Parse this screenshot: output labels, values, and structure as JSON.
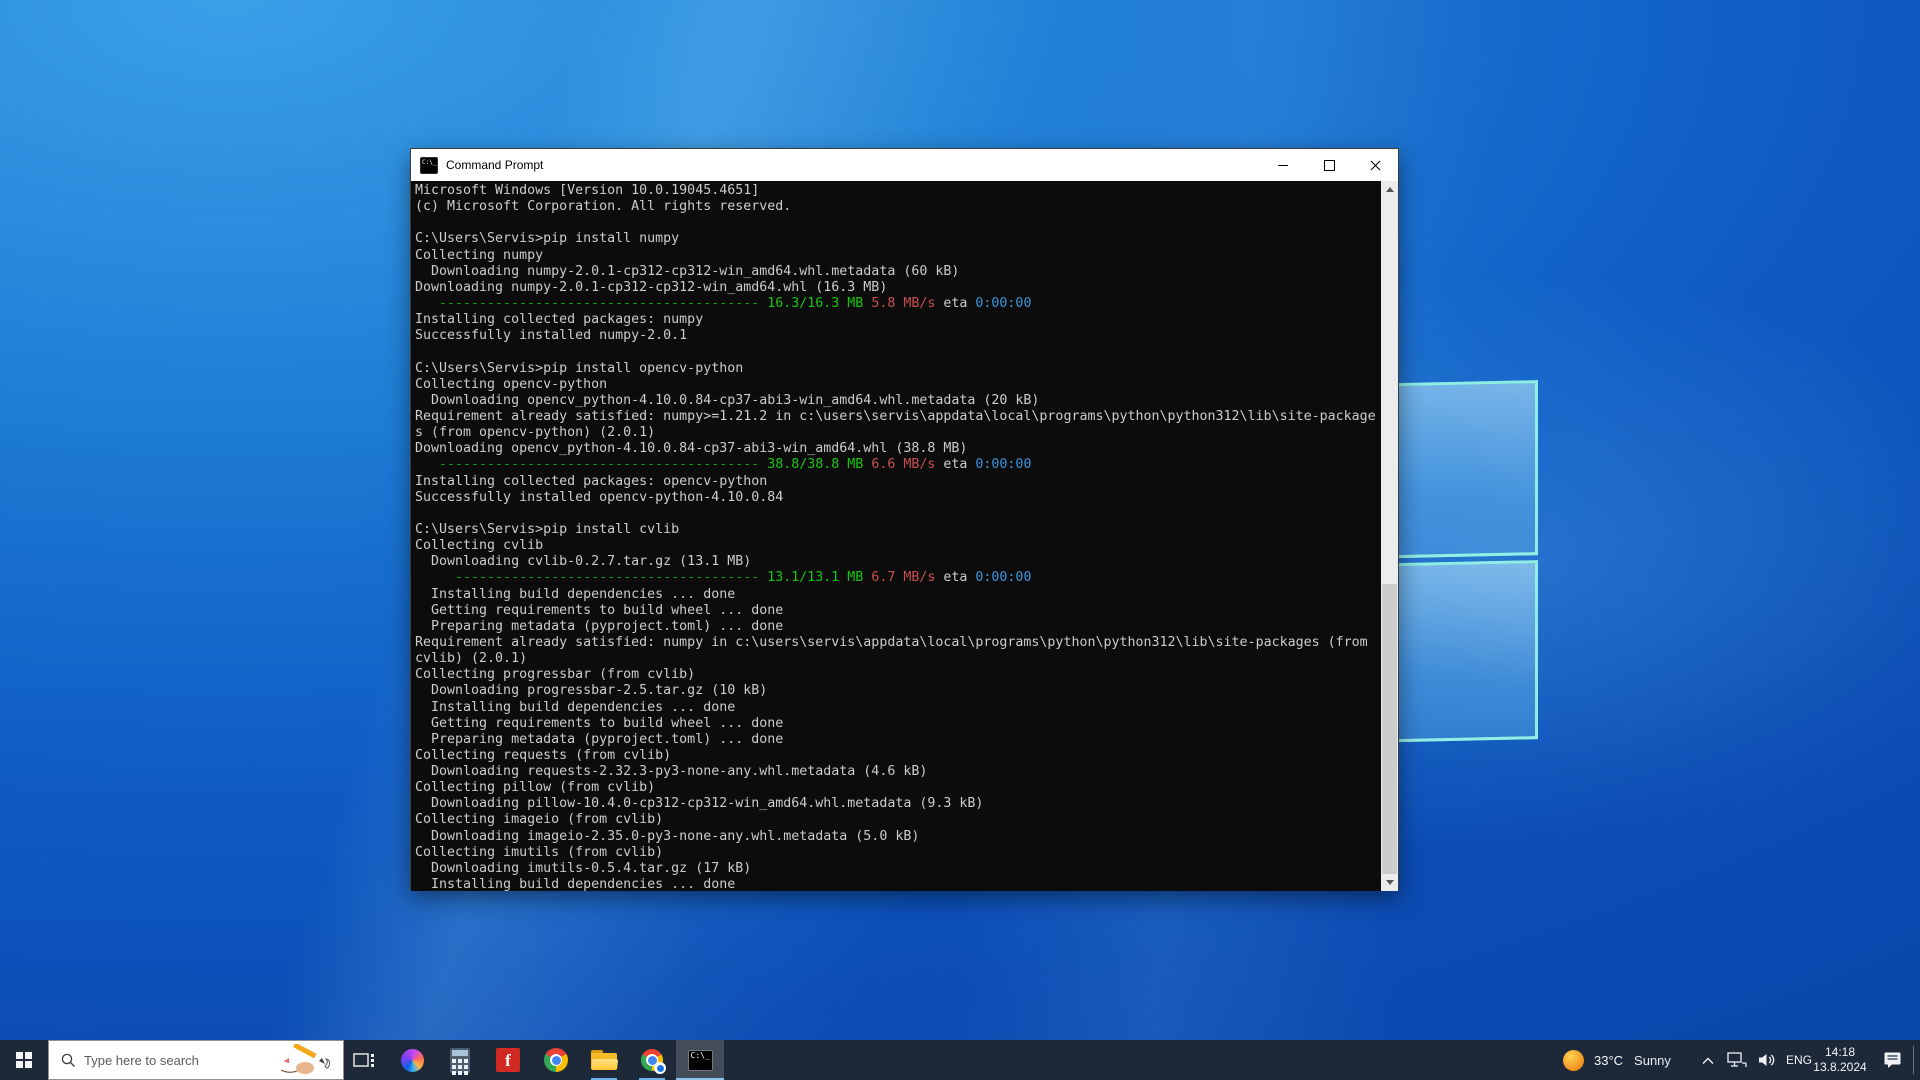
{
  "desktop": {
    "wallpaper_base": "#0d55c0",
    "logo_edge_color": "#94f2e4"
  },
  "window": {
    "title": "Command Prompt",
    "cmd_icon_text": "C:\\_",
    "controls": [
      "minimize",
      "maximize",
      "close"
    ],
    "terminal": {
      "bg": "#0c0c0c",
      "colors": {
        "fg": "#cccccc",
        "dark_green": "#13a10e",
        "green": "#16c60c",
        "red": "#c94f4f",
        "cyan": "#3a96dd"
      },
      "lines": [
        "Microsoft Windows [Version 10.0.19045.4651]",
        "(c) Microsoft Corporation. All rights reserved.",
        "",
        "C:\\Users\\Servis>pip install numpy",
        "Collecting numpy",
        "  Downloading numpy-2.0.1-cp312-cp312-win_amd64.whl.metadata (60 kB)",
        "Downloading numpy-2.0.1-cp312-cp312-win_amd64.whl (16.3 MB)",
        [
          [
            "   ----------------------------------------",
            "dg"
          ],
          [
            " 16.3/16.3 MB",
            "g"
          ],
          [
            " 5.8 MB/s",
            "r"
          ],
          [
            " eta ",
            "fg"
          ],
          [
            "0:00:00",
            "c"
          ]
        ],
        "Installing collected packages: numpy",
        "Successfully installed numpy-2.0.1",
        "",
        "C:\\Users\\Servis>pip install opencv-python",
        "Collecting opencv-python",
        "  Downloading opencv_python-4.10.0.84-cp37-abi3-win_amd64.whl.metadata (20 kB)",
        "Requirement already satisfied: numpy>=1.21.2 in c:\\users\\servis\\appdata\\local\\programs\\python\\python312\\lib\\site-package",
        "s (from opencv-python) (2.0.1)",
        "Downloading opencv_python-4.10.0.84-cp37-abi3-win_amd64.whl (38.8 MB)",
        [
          [
            "   ----------------------------------------",
            "dg"
          ],
          [
            " 38.8/38.8 MB",
            "g"
          ],
          [
            " 6.6 MB/s",
            "r"
          ],
          [
            " eta ",
            "fg"
          ],
          [
            "0:00:00",
            "c"
          ]
        ],
        "Installing collected packages: opencv-python",
        "Successfully installed opencv-python-4.10.0.84",
        "",
        "C:\\Users\\Servis>pip install cvlib",
        "Collecting cvlib",
        "  Downloading cvlib-0.2.7.tar.gz (13.1 MB)",
        [
          [
            "     --------------------------------------",
            "dg"
          ],
          [
            " 13.1/13.1 MB",
            "g"
          ],
          [
            " 6.7 MB/s",
            "r"
          ],
          [
            " eta ",
            "fg"
          ],
          [
            "0:00:00",
            "c"
          ]
        ],
        "  Installing build dependencies ... done",
        "  Getting requirements to build wheel ... done",
        "  Preparing metadata (pyproject.toml) ... done",
        "Requirement already satisfied: numpy in c:\\users\\servis\\appdata\\local\\programs\\python\\python312\\lib\\site-packages (from",
        "cvlib) (2.0.1)",
        "Collecting progressbar (from cvlib)",
        "  Downloading progressbar-2.5.tar.gz (10 kB)",
        "  Installing build dependencies ... done",
        "  Getting requirements to build wheel ... done",
        "  Preparing metadata (pyproject.toml) ... done",
        "Collecting requests (from cvlib)",
        "  Downloading requests-2.32.3-py3-none-any.whl.metadata (4.6 kB)",
        "Collecting pillow (from cvlib)",
        "  Downloading pillow-10.4.0-cp312-cp312-win_amd64.whl.metadata (9.3 kB)",
        "Collecting imageio (from cvlib)",
        "  Downloading imageio-2.35.0-py3-none-any.whl.metadata (5.0 kB)",
        "Collecting imutils (from cvlib)",
        "  Downloading imutils-0.5.4.tar.gz (17 kB)",
        "  Installing build dependencies ... done"
      ]
    }
  },
  "taskbar": {
    "bg": "#1d2939",
    "accent_underline": "#6cb2e8",
    "search": {
      "placeholder": "Type here to search"
    },
    "f_glyph": "f",
    "icons": [
      {
        "name": "start",
        "state": "none"
      },
      {
        "name": "task-view",
        "state": "none"
      },
      {
        "name": "copilot",
        "state": "none"
      },
      {
        "name": "calculator",
        "state": "none"
      },
      {
        "name": "f-app",
        "state": "none"
      },
      {
        "name": "chrome",
        "state": "none"
      },
      {
        "name": "file-explorer",
        "state": "open"
      },
      {
        "name": "chrome-profile",
        "state": "open"
      },
      {
        "name": "command-prompt",
        "state": "active"
      }
    ],
    "tray": {
      "language": "ENG",
      "time": "14:18",
      "date": "13.8.2024",
      "weather": {
        "temp": "33°C",
        "condition": "Sunny"
      }
    }
  }
}
